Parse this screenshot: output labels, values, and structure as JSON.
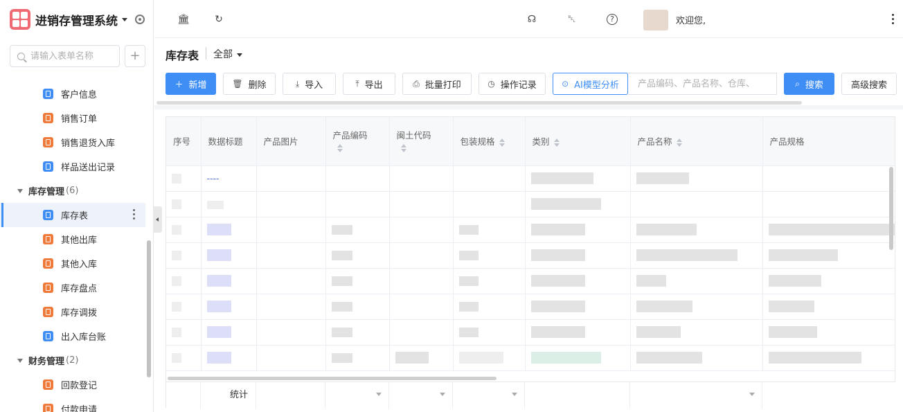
{
  "app": {
    "title": "进销存管理系统"
  },
  "sidebar": {
    "search_placeholder": "请输入表单名称",
    "add_label": "+",
    "items_top": [
      {
        "label": "客户信息",
        "color": "#3f8ef5"
      },
      {
        "label": "销售订单",
        "color": "#f07a3a"
      },
      {
        "label": "销售退货入库",
        "color": "#f07a3a"
      },
      {
        "label": "样品送出记录",
        "color": "#3f8ef5"
      }
    ],
    "group_inventory": {
      "label": "库存管理",
      "count": "(6)"
    },
    "items_inventory": [
      {
        "label": "库存表",
        "color": "#3f8ef5",
        "active": true
      },
      {
        "label": "其他出库",
        "color": "#f07a3a"
      },
      {
        "label": "其他入库",
        "color": "#f07a3a"
      },
      {
        "label": "库存盘点",
        "color": "#f07a3a"
      },
      {
        "label": "库存调拨",
        "color": "#f07a3a"
      },
      {
        "label": "出入库台账",
        "color": "#3f8ef5"
      }
    ],
    "group_finance": {
      "label": "财务管理",
      "count": "(2)"
    },
    "items_finance": [
      {
        "label": "回款登记",
        "color": "#f07a3a"
      },
      {
        "label": "付款申请",
        "color": "#f07a3a"
      }
    ]
  },
  "topbar": {
    "icons": [
      "bank-icon",
      "refresh-icon",
      "headset-icon",
      "bell-icon",
      "help-icon"
    ],
    "welcome": "欢迎您,"
  },
  "page": {
    "title": "库存表",
    "view": "全部"
  },
  "toolbar": {
    "add": "新增",
    "delete": "删除",
    "import": "导入",
    "export": "导出",
    "batch_print": "批量打印",
    "op_log": "操作记录",
    "ai_analysis": "AI模型分析",
    "search_placeholder": "产品编码、产品名称、仓库、",
    "search_btn": "搜索",
    "advanced": "高级搜索"
  },
  "table": {
    "columns": [
      "序号",
      "数据标题",
      "产品图片",
      "产品编码",
      "闽土代码",
      "包装规格",
      "类别",
      "产品名称",
      "产品规格"
    ],
    "first_row_title": "----",
    "footer_label": "统计"
  },
  "colors": {
    "accent": "#3f8ef5",
    "icon_orange": "#f07a3a",
    "logo": "#ef6a73"
  }
}
